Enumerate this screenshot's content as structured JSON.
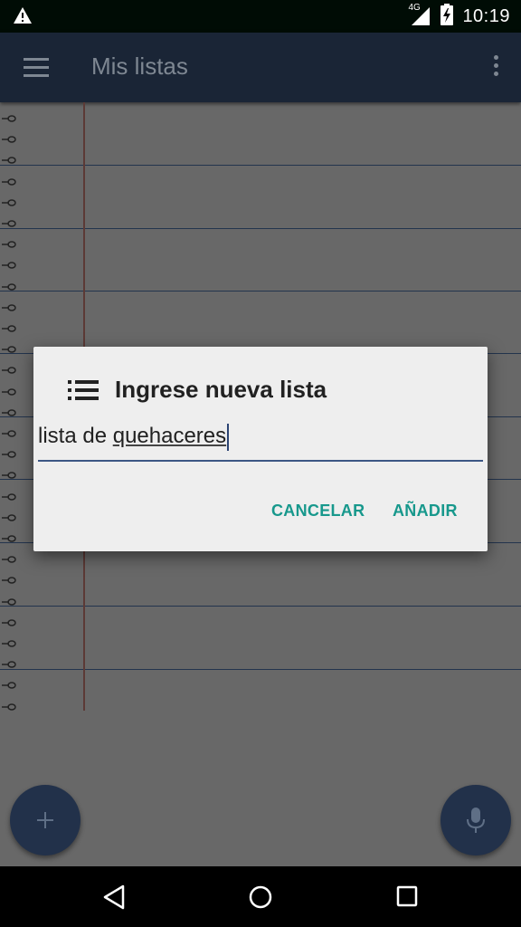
{
  "status_bar": {
    "time": "10:19",
    "network": "4G",
    "icons": [
      "warning-icon",
      "signal-icon",
      "battery-charging-icon"
    ]
  },
  "app_bar": {
    "title": "Mis listas",
    "icons": [
      "menu-icon",
      "overflow-menu-icon"
    ]
  },
  "dialog": {
    "title": "Ingrese nueva lista",
    "icon": "list-icon",
    "input_value_part1": "lista de ",
    "input_value_part2": "quehaceres",
    "cancel_label": "CANCELAR",
    "add_label": "AÑADIR"
  },
  "fabs": {
    "add_icon": "plus-icon",
    "mic_icon": "mic-icon"
  },
  "nav_bar": {
    "icons": [
      "back-icon",
      "home-icon",
      "recents-icon"
    ]
  },
  "colors": {
    "status_bar": "#000c05",
    "app_bar": "#1a2536",
    "scrim_background": "#686868",
    "accent": "#17988c",
    "input_underline": "#3c5684",
    "fab": "#22314a"
  }
}
